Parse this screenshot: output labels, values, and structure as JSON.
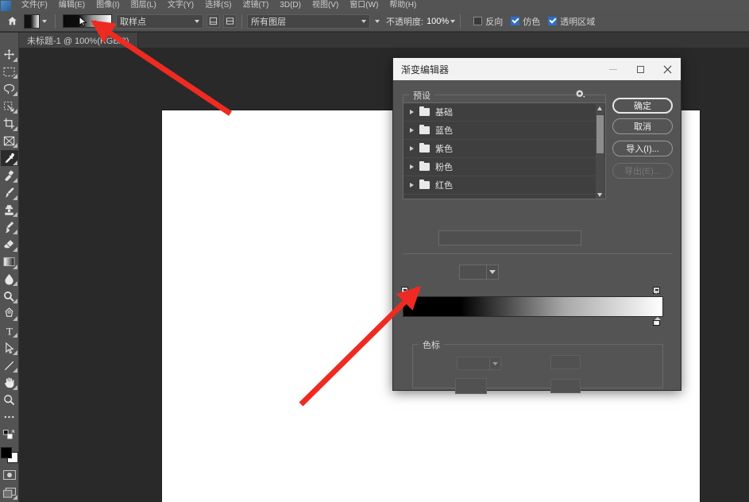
{
  "app": {
    "menu": [
      "文件(F)",
      "编辑(E)",
      "图像(I)",
      "图层(L)",
      "文字(Y)",
      "选择(S)",
      "滤镜(T)",
      "3D(D)",
      "视图(V)",
      "窗口(W)",
      "帮助(H)"
    ]
  },
  "options_bar": {
    "home_icon": "home-icon",
    "tool_preset_icon": "gradient-tool-preset-icon",
    "gradient_preview": "gradient-swatch",
    "mode_select": "取样点",
    "mode_icon_1": "gradient-mode-icon",
    "mode_icon_2": "gradient-shape-icon",
    "layer_select": "所有图层",
    "opacity_label": "不透明度:",
    "opacity_value": "100%",
    "reverse_label": "反向",
    "reverse_checked": false,
    "dither_label": "仿色",
    "dither_checked": true,
    "transparency_label": "透明区域",
    "transparency_checked": true
  },
  "document": {
    "tab_title": "未标题-1 @ 100%(RGB/8)"
  },
  "toolbar": {
    "tools": [
      {
        "name": "move-tool",
        "glyph": "move"
      },
      {
        "name": "marquee-tool",
        "glyph": "marquee"
      },
      {
        "name": "lasso-tool",
        "glyph": "lasso"
      },
      {
        "name": "quick-selection-tool",
        "glyph": "quickselect"
      },
      {
        "name": "crop-tool",
        "glyph": "crop"
      },
      {
        "name": "frame-tool",
        "glyph": "frame"
      },
      {
        "name": "eyedropper-tool",
        "glyph": "eyedropper",
        "active": true
      },
      {
        "name": "healing-brush-tool",
        "glyph": "heal"
      },
      {
        "name": "brush-tool",
        "glyph": "brush"
      },
      {
        "name": "clone-stamp-tool",
        "glyph": "stamp"
      },
      {
        "name": "history-brush-tool",
        "glyph": "historybrush"
      },
      {
        "name": "eraser-tool",
        "glyph": "eraser"
      },
      {
        "name": "gradient-tool",
        "glyph": "gradient"
      },
      {
        "name": "blur-tool",
        "glyph": "blur"
      },
      {
        "name": "dodge-tool",
        "glyph": "dodge"
      },
      {
        "name": "pen-tool",
        "glyph": "pen"
      },
      {
        "name": "type-tool",
        "glyph": "type"
      },
      {
        "name": "path-selection-tool",
        "glyph": "pathselect"
      },
      {
        "name": "line-shape-tool",
        "glyph": "line"
      },
      {
        "name": "hand-tool",
        "glyph": "hand"
      },
      {
        "name": "zoom-tool",
        "glyph": "zoom"
      },
      {
        "name": "edit-toolbar-button",
        "glyph": "ellipsis"
      },
      {
        "name": "default-colors-icon",
        "glyph": "defaultcolors"
      }
    ],
    "foreground_color": "#000000",
    "background_color": "#ffffff",
    "quick_mask_icon": "quick-mask-icon",
    "screen_mode_icon": "screen-mode-icon"
  },
  "dialog": {
    "title": "渐变编辑器",
    "minimize_icon": "minimize-icon",
    "maximize_icon": "maximize-icon",
    "close_icon": "close-icon",
    "preset_group_label": "预设",
    "gear_icon": "gear-icon",
    "preset_items": [
      {
        "label": "基础",
        "icon": "folder-icon"
      },
      {
        "label": "蓝色",
        "icon": "folder-icon"
      },
      {
        "label": "紫色",
        "icon": "folder-icon"
      },
      {
        "label": "粉色",
        "icon": "folder-icon"
      },
      {
        "label": "红色",
        "icon": "folder-icon"
      }
    ],
    "buttons": [
      {
        "label": "确定",
        "name": "ok-button",
        "style": "primary",
        "disabled": false
      },
      {
        "label": "取消",
        "name": "cancel-button",
        "style": "normal",
        "disabled": false
      },
      {
        "label": "导入(I)...",
        "name": "import-button",
        "style": "normal",
        "disabled": false
      },
      {
        "label": "导出(E)...",
        "name": "export-button",
        "style": "normal",
        "disabled": true
      }
    ],
    "name_field_value": "",
    "gradient_type_value": "",
    "gradient_stops_group_label": "色标",
    "gradient_start_color": "#000000",
    "gradient_end_color": "#ffffff",
    "stop_fields": [
      {
        "name": "opacity-field",
        "value": ""
      },
      {
        "name": "location-field-top",
        "value": ""
      },
      {
        "name": "color-swatch-field",
        "value": ""
      },
      {
        "name": "location-field-bottom",
        "value": ""
      }
    ]
  },
  "annotations": {
    "arrow_color": "#ee2b22",
    "arrow_1": "points-to-gradient-swatch-in-options-bar",
    "arrow_2": "points-to-gradient-bar-in-dialog"
  },
  "colors": {
    "window_bg": "#292929",
    "panel_bg": "#535353",
    "dialog_bg": "#545454",
    "titlebar_bg": "#f2f2f2",
    "accent_blue": "#2f6fc4",
    "canvas_white": "#ffffff"
  }
}
